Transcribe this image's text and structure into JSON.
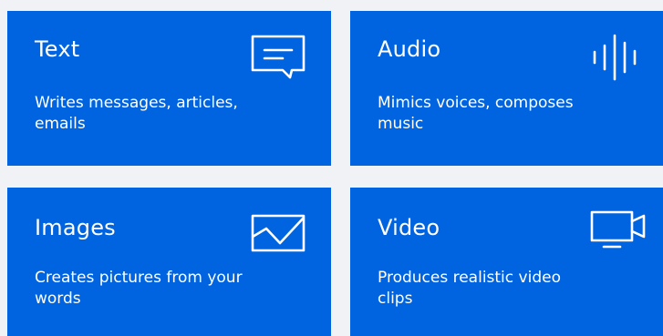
{
  "cards": [
    {
      "title": "Text",
      "description": "Writes messages, articles, emails",
      "icon": "chat-bubble-icon"
    },
    {
      "title": "Audio",
      "description": "Mimics voices, composes music",
      "icon": "sound-wave-icon"
    },
    {
      "title": "Images",
      "description": "Creates pictures from your words",
      "icon": "image-icon"
    },
    {
      "title": "Video",
      "description": "Produces realistic video clips",
      "icon": "video-camera-icon"
    }
  ],
  "colors": {
    "card_background": "#0064e0",
    "page_background": "#f0f2f5",
    "text": "#ffffff"
  }
}
